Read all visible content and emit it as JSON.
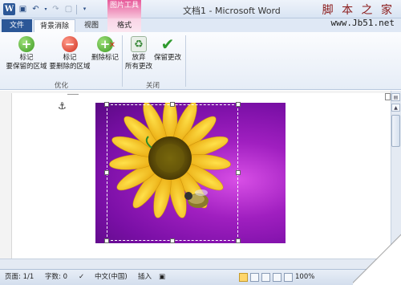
{
  "window": {
    "title": "文档1 - Microsoft Word",
    "context_tab_title": "图片工具"
  },
  "watermark": {
    "line1": "脚 本 之 家",
    "line2": "www.Jb51.net"
  },
  "tabs": {
    "file": "文件",
    "background_removal": "背景消除",
    "view": "视图",
    "format": "格式"
  },
  "ribbon": {
    "mark_keep": {
      "line1": "标记",
      "line2": "要保留的区域",
      "icon": "plus-circle-icon"
    },
    "mark_remove": {
      "line1": "标记",
      "line2": "要删除的区域",
      "icon": "minus-circle-icon"
    },
    "delete_mark": {
      "label": "删除标记",
      "icon": "delete-mark-icon"
    },
    "discard": {
      "line1": "放弃",
      "line2": "所有更改",
      "icon": "recycle-icon"
    },
    "keep_changes": {
      "label": "保留更改",
      "icon": "checkmark-icon"
    },
    "group_refine": "优化",
    "group_close": "关闭"
  },
  "status": {
    "page": "页面: 1/1",
    "words": "字数: 0",
    "language": "中文(中国)",
    "mode": "插入",
    "zoom": "100%"
  },
  "colors": {
    "accent": "#2b5797",
    "context": "#e75a9a",
    "image_bg": "#a01fc0",
    "petal": "#f4c21a"
  }
}
